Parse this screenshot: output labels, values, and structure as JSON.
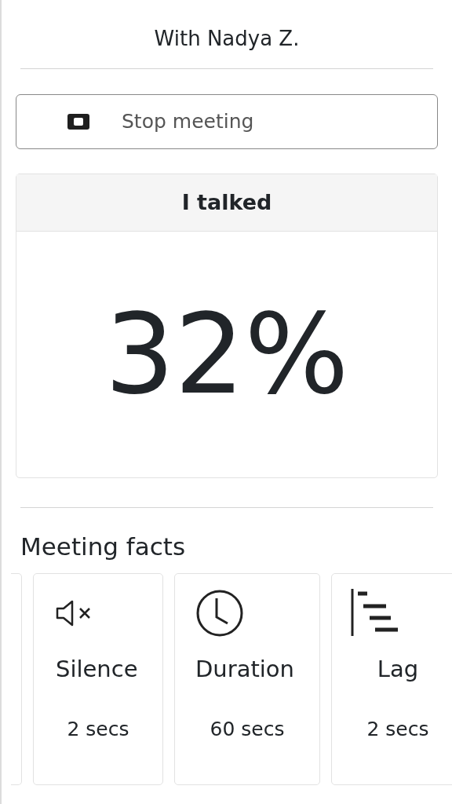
{
  "header": {
    "title": "With Nadya Z."
  },
  "stop_button": {
    "label": "Stop meeting"
  },
  "talk_card": {
    "header": "I talked",
    "value": "32%"
  },
  "facts": {
    "heading": "Meeting facts",
    "items": [
      {
        "kind": "silence",
        "label": "Silence",
        "value": "2 secs"
      },
      {
        "kind": "duration",
        "label": "Duration",
        "value": "60 secs"
      },
      {
        "kind": "lag",
        "label": "Lag",
        "value": "2 secs"
      }
    ]
  }
}
